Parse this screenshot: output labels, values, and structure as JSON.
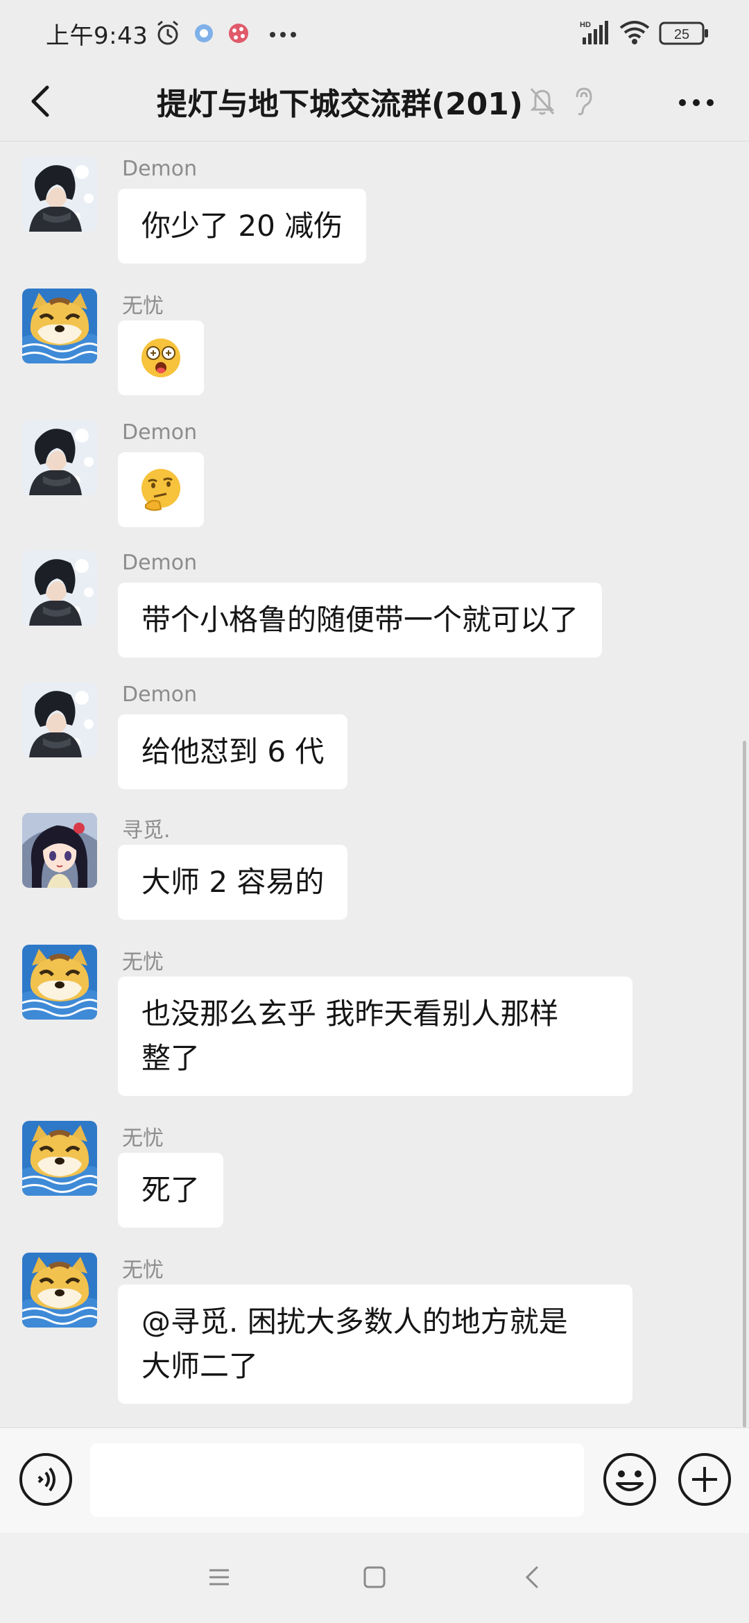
{
  "status_bar": {
    "time": "上午9:43",
    "battery": "25",
    "network": "HD"
  },
  "header": {
    "title": "提灯与地下城交流群(201)"
  },
  "messages": [
    {
      "sender": "Demon",
      "text": "你少了 20 减伤",
      "avatar": "anime-boy-avatar"
    },
    {
      "sender": "无忧",
      "text": "",
      "emoji": "surprised-tongue-emoji",
      "avatar": "doge-avatar"
    },
    {
      "sender": "Demon",
      "text": "",
      "emoji": "thinking-emoji",
      "avatar": "anime-boy-avatar"
    },
    {
      "sender": "Demon",
      "text": "带个小格鲁的随便带一个就可以了",
      "avatar": "anime-boy-avatar"
    },
    {
      "sender": "Demon",
      "text": "给他怼到 6 代",
      "avatar": "anime-boy-avatar"
    },
    {
      "sender": "寻觅.",
      "text": "大师 2 容易的",
      "avatar": "anime-girl-avatar"
    },
    {
      "sender": "无忧",
      "line1": "也没那么玄乎 我昨天看别人那样",
      "line2": "整了",
      "avatar": "doge-avatar"
    },
    {
      "sender": "无忧",
      "text": "死了",
      "avatar": "doge-avatar"
    },
    {
      "sender": "无忧",
      "line1": "@寻觅. 困扰大多数人的地方就是",
      "line2": "大师二了",
      "avatar": "doge-avatar"
    }
  ],
  "colors": {
    "background": "#ededed",
    "bubble": "#ffffff",
    "sender": "#8c8c8c"
  }
}
